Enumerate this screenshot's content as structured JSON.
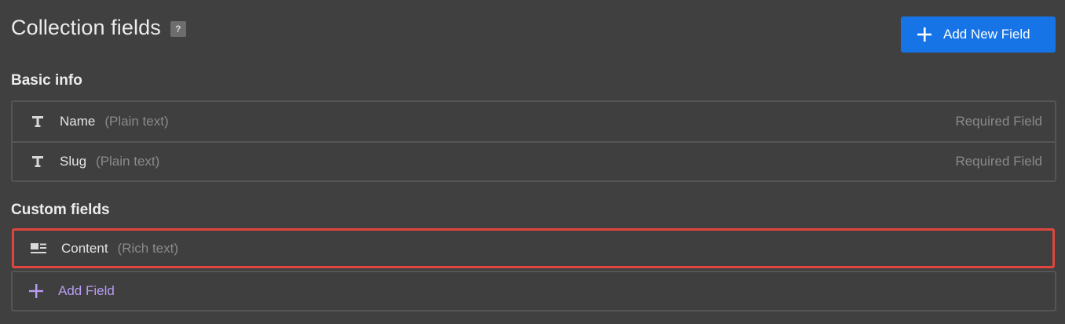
{
  "header": {
    "title": "Collection fields",
    "help_label": "?"
  },
  "actions": {
    "add_new_field_label": "Add New Field"
  },
  "sections": {
    "basic": {
      "label": "Basic info",
      "fields": [
        {
          "name": "Name",
          "type": "(Plain text)",
          "note": "Required Field",
          "icon": "text-type-icon"
        },
        {
          "name": "Slug",
          "type": "(Plain text)",
          "note": "Required Field",
          "icon": "text-type-icon"
        }
      ]
    },
    "custom": {
      "label": "Custom fields",
      "fields": [
        {
          "name": "Content",
          "type": "(Rich text)",
          "icon": "rich-text-icon",
          "selected": true
        }
      ],
      "add_field_label": "Add Field"
    }
  },
  "colors": {
    "background": "#404040",
    "primary_button": "#1774e6",
    "selection_outline": "#e0463e",
    "add_field_accent": "#b89cf3"
  }
}
